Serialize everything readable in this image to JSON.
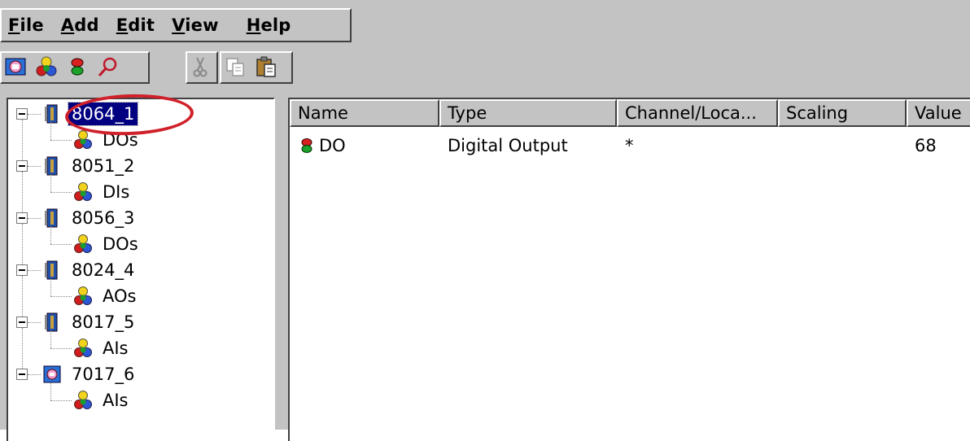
{
  "menu": {
    "items": [
      {
        "pre": "",
        "u": "F",
        "post": "ile"
      },
      {
        "pre": "",
        "u": "A",
        "post": "dd"
      },
      {
        "pre": "",
        "u": "E",
        "post": "dit"
      },
      {
        "pre": "",
        "u": "V",
        "post": "iew"
      },
      {
        "pre": "",
        "u": "H",
        "post": "elp"
      }
    ]
  },
  "toolbar": {
    "icons": [
      "module-icon",
      "channel-group-icon",
      "channel-icon",
      "search-icon",
      "cut-icon",
      "copy-icon",
      "paste-icon"
    ]
  },
  "tree": {
    "modules": [
      {
        "label": "8064_1",
        "icon": "io-module-icon",
        "child": "DOs",
        "selected": true
      },
      {
        "label": "8051_2",
        "icon": "io-module-icon",
        "child": "DIs",
        "selected": false
      },
      {
        "label": "8056_3",
        "icon": "io-module-icon",
        "child": "DOs",
        "selected": false
      },
      {
        "label": "8024_4",
        "icon": "io-module-icon",
        "child": "AOs",
        "selected": false
      },
      {
        "label": "8017_5",
        "icon": "io-module-icon",
        "child": "AIs",
        "selected": false
      },
      {
        "label": "7017_6",
        "icon": "remote-module-icon",
        "child": "AIs",
        "selected": false
      }
    ]
  },
  "list": {
    "columns": [
      "Name",
      "Type",
      "Channel/Loca...",
      "Scaling",
      "Value"
    ],
    "rows": [
      {
        "name": "DO",
        "type": "Digital Output",
        "channel": "*",
        "scaling": "",
        "value": "68"
      }
    ]
  },
  "colors": {
    "chrome": "#c3c3c3",
    "selection": "#000080",
    "annotation_ring": "#d0202a"
  }
}
